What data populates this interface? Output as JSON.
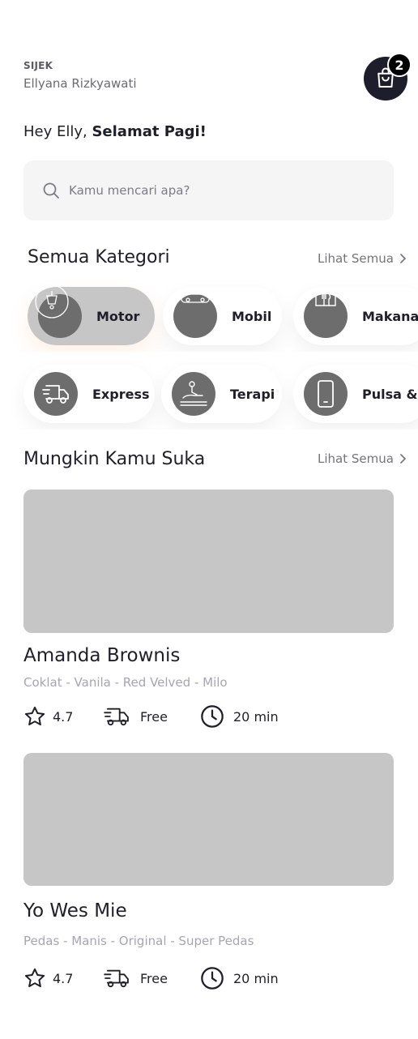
{
  "header": {
    "brand": "SIJEK",
    "user_name": "Ellyana Rizkyawati",
    "cart_count": "2",
    "cart_icon": "shopping-bag-icon"
  },
  "greeting": {
    "prefix": "Hey Elly, ",
    "emphasis": "Selamat Pagi!"
  },
  "search": {
    "placeholder": "Kamu mencari apa?",
    "icon": "search-icon"
  },
  "categories": {
    "title": "Semua Kategori",
    "see_all": "Lihat Semua",
    "items": [
      {
        "label": "Motor",
        "icon": "scooter-icon",
        "active": true
      },
      {
        "label": "Mobil",
        "icon": "car-icon",
        "active": false
      },
      {
        "label": "Makanan",
        "icon": "food-icon",
        "active": false
      },
      {
        "label": "Express",
        "icon": "delivery-truck-icon",
        "active": false
      },
      {
        "label": "Terapi",
        "icon": "massage-icon",
        "active": false
      },
      {
        "label": "Pulsa & lis",
        "icon": "phone-icon",
        "active": false
      }
    ]
  },
  "recommendations": {
    "title": "Mungkin Kamu Suka",
    "see_all": "Lihat Semua",
    "items": [
      {
        "name": "Amanda Brownis",
        "variants": "Coklat - Vanila - Red Velved - Milo",
        "rating": "4.7",
        "delivery": "Free",
        "time": "20 min"
      },
      {
        "name": "Yo Wes Mie",
        "variants": "Pedas - Manis - Original - Super Pedas",
        "rating": "4.7",
        "delivery": "Free",
        "time": "20 min"
      }
    ]
  },
  "colors": {
    "accent_dark": "#1d1d2b",
    "placeholder_gray": "#c6c6c6",
    "muted_text": "#a5a5b5"
  }
}
